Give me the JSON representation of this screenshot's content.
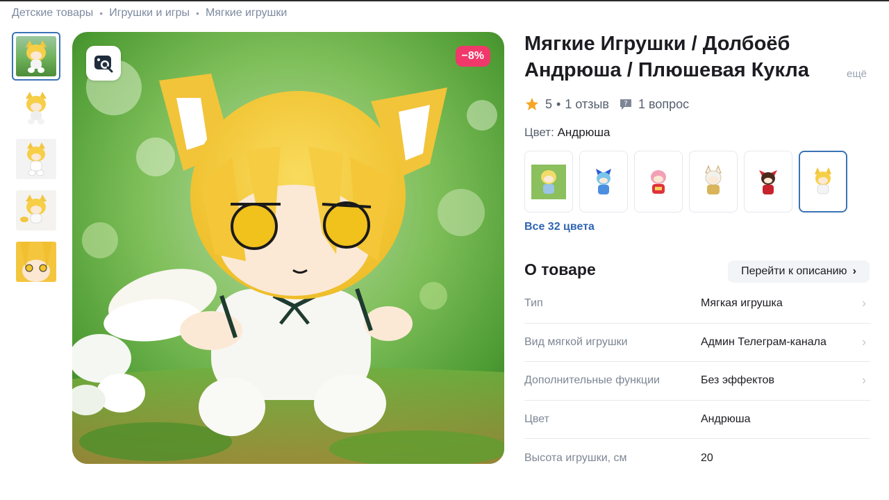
{
  "breadcrumb": [
    "Детские товары",
    "Игрушки и игры",
    "Мягкие игрушки"
  ],
  "product": {
    "title": "Мягкие Игрушки / Долбоёб Андрюша / Плюшевая Кукла",
    "more": "ещё",
    "discount": "−8%",
    "rating": "5",
    "reviews": "1 отзыв",
    "questions": "1 вопрос",
    "color_label": "Цвет:",
    "color_value": "Андрюша",
    "all_colors": "Все 32 цвета"
  },
  "thumbnails": [
    "thumb-1",
    "thumb-2",
    "thumb-3",
    "thumb-4",
    "thumb-5"
  ],
  "swatches": [
    "swatch-green-doll",
    "swatch-blue-doll",
    "swatch-red-doll",
    "swatch-white-doll",
    "swatch-shrine-doll",
    "swatch-fox-doll"
  ],
  "about": {
    "title": "О товаре",
    "go_description": "Перейти к описанию",
    "specs": [
      {
        "name": "Тип",
        "value": "Мягкая игрушка"
      },
      {
        "name": "Вид мягкой игрушки",
        "value": "Админ Телеграм-канала"
      },
      {
        "name": "Дополнительные функции",
        "value": "Без эффектов"
      },
      {
        "name": "Цвет",
        "value": "Андрюша"
      },
      {
        "name": "Высота игрушки, см",
        "value": "20"
      }
    ]
  },
  "colors": {
    "accent": "#3a72b6",
    "link": "#2f65b0",
    "discount": "#f0386b",
    "star": "#f5a623"
  }
}
